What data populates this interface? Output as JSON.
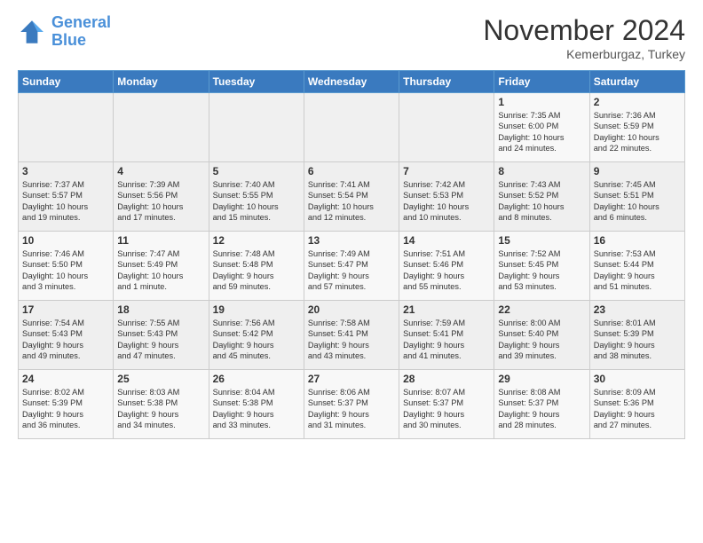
{
  "logo": {
    "line1": "General",
    "line2": "Blue"
  },
  "title": "November 2024",
  "subtitle": "Kemerburgaz, Turkey",
  "weekdays": [
    "Sunday",
    "Monday",
    "Tuesday",
    "Wednesday",
    "Thursday",
    "Friday",
    "Saturday"
  ],
  "weeks": [
    [
      {
        "day": "",
        "info": ""
      },
      {
        "day": "",
        "info": ""
      },
      {
        "day": "",
        "info": ""
      },
      {
        "day": "",
        "info": ""
      },
      {
        "day": "",
        "info": ""
      },
      {
        "day": "1",
        "info": "Sunrise: 7:35 AM\nSunset: 6:00 PM\nDaylight: 10 hours\nand 24 minutes."
      },
      {
        "day": "2",
        "info": "Sunrise: 7:36 AM\nSunset: 5:59 PM\nDaylight: 10 hours\nand 22 minutes."
      }
    ],
    [
      {
        "day": "3",
        "info": "Sunrise: 7:37 AM\nSunset: 5:57 PM\nDaylight: 10 hours\nand 19 minutes."
      },
      {
        "day": "4",
        "info": "Sunrise: 7:39 AM\nSunset: 5:56 PM\nDaylight: 10 hours\nand 17 minutes."
      },
      {
        "day": "5",
        "info": "Sunrise: 7:40 AM\nSunset: 5:55 PM\nDaylight: 10 hours\nand 15 minutes."
      },
      {
        "day": "6",
        "info": "Sunrise: 7:41 AM\nSunset: 5:54 PM\nDaylight: 10 hours\nand 12 minutes."
      },
      {
        "day": "7",
        "info": "Sunrise: 7:42 AM\nSunset: 5:53 PM\nDaylight: 10 hours\nand 10 minutes."
      },
      {
        "day": "8",
        "info": "Sunrise: 7:43 AM\nSunset: 5:52 PM\nDaylight: 10 hours\nand 8 minutes."
      },
      {
        "day": "9",
        "info": "Sunrise: 7:45 AM\nSunset: 5:51 PM\nDaylight: 10 hours\nand 6 minutes."
      }
    ],
    [
      {
        "day": "10",
        "info": "Sunrise: 7:46 AM\nSunset: 5:50 PM\nDaylight: 10 hours\nand 3 minutes."
      },
      {
        "day": "11",
        "info": "Sunrise: 7:47 AM\nSunset: 5:49 PM\nDaylight: 10 hours\nand 1 minute."
      },
      {
        "day": "12",
        "info": "Sunrise: 7:48 AM\nSunset: 5:48 PM\nDaylight: 9 hours\nand 59 minutes."
      },
      {
        "day": "13",
        "info": "Sunrise: 7:49 AM\nSunset: 5:47 PM\nDaylight: 9 hours\nand 57 minutes."
      },
      {
        "day": "14",
        "info": "Sunrise: 7:51 AM\nSunset: 5:46 PM\nDaylight: 9 hours\nand 55 minutes."
      },
      {
        "day": "15",
        "info": "Sunrise: 7:52 AM\nSunset: 5:45 PM\nDaylight: 9 hours\nand 53 minutes."
      },
      {
        "day": "16",
        "info": "Sunrise: 7:53 AM\nSunset: 5:44 PM\nDaylight: 9 hours\nand 51 minutes."
      }
    ],
    [
      {
        "day": "17",
        "info": "Sunrise: 7:54 AM\nSunset: 5:43 PM\nDaylight: 9 hours\nand 49 minutes."
      },
      {
        "day": "18",
        "info": "Sunrise: 7:55 AM\nSunset: 5:43 PM\nDaylight: 9 hours\nand 47 minutes."
      },
      {
        "day": "19",
        "info": "Sunrise: 7:56 AM\nSunset: 5:42 PM\nDaylight: 9 hours\nand 45 minutes."
      },
      {
        "day": "20",
        "info": "Sunrise: 7:58 AM\nSunset: 5:41 PM\nDaylight: 9 hours\nand 43 minutes."
      },
      {
        "day": "21",
        "info": "Sunrise: 7:59 AM\nSunset: 5:41 PM\nDaylight: 9 hours\nand 41 minutes."
      },
      {
        "day": "22",
        "info": "Sunrise: 8:00 AM\nSunset: 5:40 PM\nDaylight: 9 hours\nand 39 minutes."
      },
      {
        "day": "23",
        "info": "Sunrise: 8:01 AM\nSunset: 5:39 PM\nDaylight: 9 hours\nand 38 minutes."
      }
    ],
    [
      {
        "day": "24",
        "info": "Sunrise: 8:02 AM\nSunset: 5:39 PM\nDaylight: 9 hours\nand 36 minutes."
      },
      {
        "day": "25",
        "info": "Sunrise: 8:03 AM\nSunset: 5:38 PM\nDaylight: 9 hours\nand 34 minutes."
      },
      {
        "day": "26",
        "info": "Sunrise: 8:04 AM\nSunset: 5:38 PM\nDaylight: 9 hours\nand 33 minutes."
      },
      {
        "day": "27",
        "info": "Sunrise: 8:06 AM\nSunset: 5:37 PM\nDaylight: 9 hours\nand 31 minutes."
      },
      {
        "day": "28",
        "info": "Sunrise: 8:07 AM\nSunset: 5:37 PM\nDaylight: 9 hours\nand 30 minutes."
      },
      {
        "day": "29",
        "info": "Sunrise: 8:08 AM\nSunset: 5:37 PM\nDaylight: 9 hours\nand 28 minutes."
      },
      {
        "day": "30",
        "info": "Sunrise: 8:09 AM\nSunset: 5:36 PM\nDaylight: 9 hours\nand 27 minutes."
      }
    ]
  ]
}
